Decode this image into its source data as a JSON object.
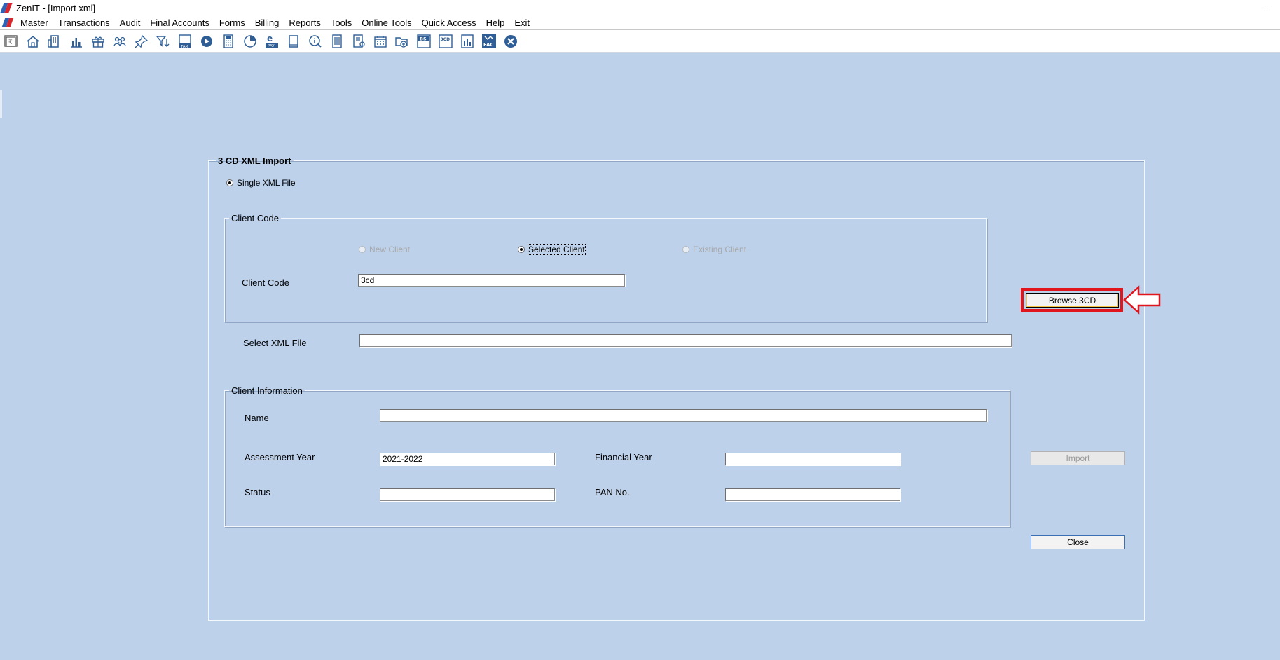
{
  "window": {
    "title": "ZenIT - [Import xml]",
    "minimize_glyph": "–"
  },
  "menu": [
    "Master",
    "Transactions",
    "Audit",
    "Final Accounts",
    "Forms",
    "Billing",
    "Reports",
    "Tools",
    "Online Tools",
    "Quick Access",
    "Help",
    "Exit"
  ],
  "toolbar": {
    "icons": [
      "rupee-icon",
      "home-icon",
      "building-icon",
      "bar-chart-icon",
      "gift-icon",
      "users-icon",
      "pin-icon",
      "filter-icon",
      "tax-icon",
      "play-icon",
      "calculator-icon",
      "pie-icon",
      "pay-icon",
      "book-icon",
      "info-icon",
      "sheet-icon",
      "contact-icon",
      "calendar-icon",
      "folder-add-icon",
      "bs-icon",
      "3cd-icon",
      "report-icon",
      "fac-icon",
      "close-circle-icon"
    ],
    "labels": {
      "bs": "BS",
      "3cd": "3CD",
      "fac": "FAC",
      "tax": "TAX",
      "pay": "PAY"
    }
  },
  "form": {
    "group_title": "3 CD XML Import",
    "single_xml_label": "Single XML File",
    "client_code_group": "Client Code",
    "radio_new": "New Client",
    "radio_selected": "Selected Client",
    "radio_existing": "Existing Client",
    "client_code_label": "Client Code",
    "client_code_value": "3cd",
    "select_xml_label": "Select XML File",
    "select_xml_value": "",
    "client_info_group": "Client Information",
    "name_label": "Name",
    "name_value": "",
    "ay_label": "Assessment Year",
    "ay_value": "2021-2022",
    "fy_label": "Financial Year",
    "fy_value": "",
    "status_label": "Status",
    "status_value": "",
    "pan_label": "PAN No.",
    "pan_value": ""
  },
  "buttons": {
    "browse": "Browse 3CD",
    "import": "Import",
    "close": "Close"
  },
  "colors": {
    "background": "#bdd1eb",
    "highlight": "#e1161d"
  }
}
